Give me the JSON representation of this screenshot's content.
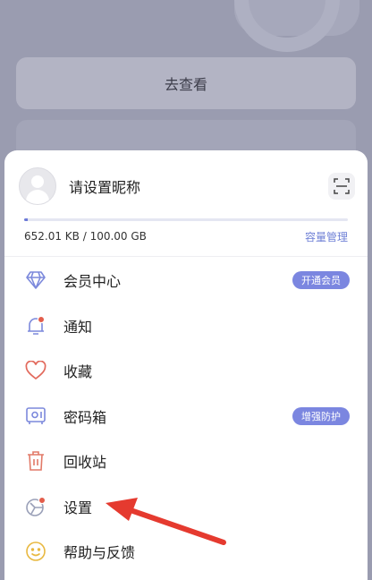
{
  "background": {
    "goto_label": "去查看"
  },
  "profile": {
    "nickname": "请设置昵称"
  },
  "storage": {
    "usage_text": "652.01 KB / 100.00 GB",
    "usage_fraction": 0.01,
    "manage_label": "容量管理"
  },
  "menu": [
    {
      "label": "会员中心",
      "icon": "diamond-icon",
      "badge": "开通会员"
    },
    {
      "label": "通知",
      "icon": "notification-icon",
      "dot": true
    },
    {
      "label": "收藏",
      "icon": "heart-icon"
    },
    {
      "label": "密码箱",
      "icon": "safe-box-icon",
      "badge": "增强防护"
    },
    {
      "label": "回收站",
      "icon": "trash-icon"
    },
    {
      "label": "设置",
      "icon": "settings-icon",
      "dot": true
    },
    {
      "label": "帮助与反馈",
      "icon": "help-feedback-icon"
    }
  ],
  "colors": {
    "accent": "#6d7bd8",
    "icon_stroke": "#7c89dc",
    "heart": "#e26a5d",
    "trash": "#e27a68",
    "help": "#e8b840",
    "annotation_arrow": "#e53a2f",
    "notification_dot": "#e35d4b"
  }
}
